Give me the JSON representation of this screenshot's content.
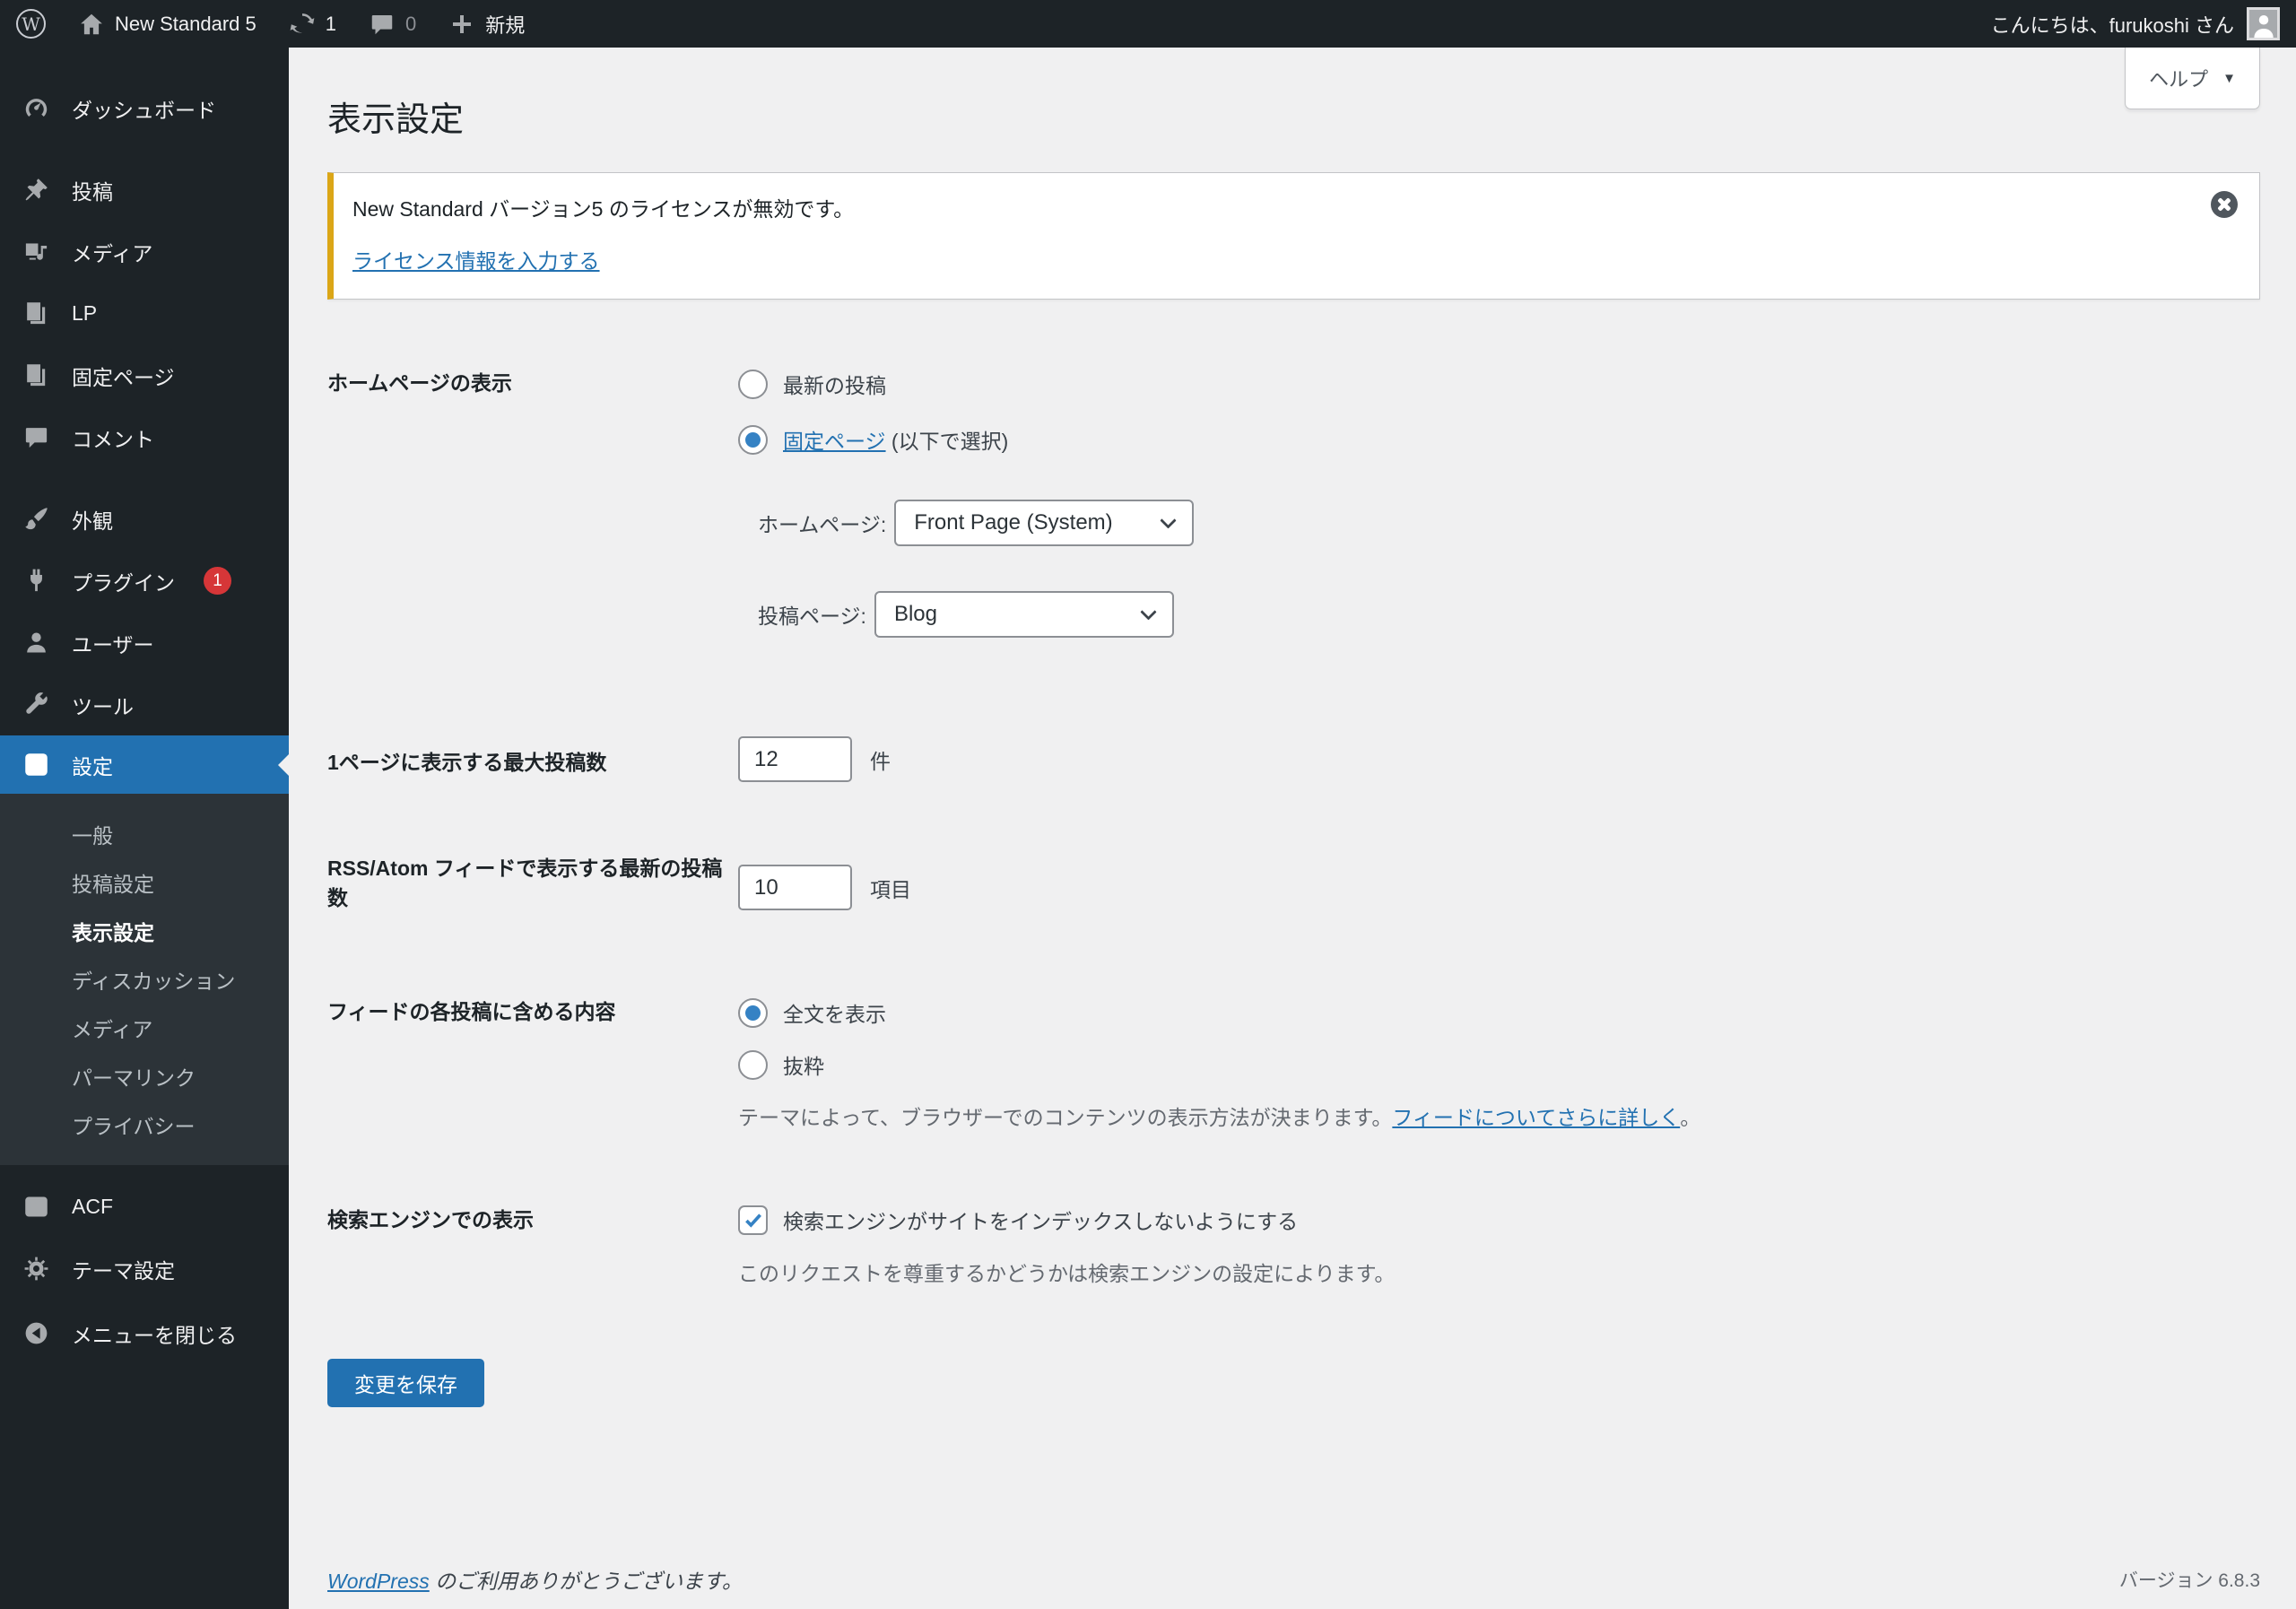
{
  "admin_bar": {
    "wp_logo_glyph": "W",
    "site_name": "New Standard 5",
    "update_count": "1",
    "comment_count": "0",
    "new_label": "新規",
    "greeting": "こんにちは、furukoshi さん"
  },
  "sidebar": {
    "items": [
      {
        "label": "ダッシュボード"
      },
      {
        "label": "投稿"
      },
      {
        "label": "メディア"
      },
      {
        "label": "LP"
      },
      {
        "label": "固定ページ"
      },
      {
        "label": "コメント"
      },
      {
        "label": "外観"
      },
      {
        "label": "プラグイン",
        "badge": "1"
      },
      {
        "label": "ユーザー"
      },
      {
        "label": "ツール"
      },
      {
        "label": "設定"
      }
    ],
    "settings_submenu": [
      "一般",
      "投稿設定",
      "表示設定",
      "ディスカッション",
      "メディア",
      "パーマリンク",
      "プライバシー"
    ],
    "bottom_items": [
      "ACF",
      "テーマ設定",
      "メニューを閉じる"
    ]
  },
  "page": {
    "title": "表示設定",
    "help_label": "ヘルプ",
    "help_caret": "▼"
  },
  "notice": {
    "message": "New Standard バージョン5 のライセンスが無効です。",
    "link": "ライセンス情報を入力する"
  },
  "form": {
    "homepage_row": {
      "label": "ホームページの表示",
      "radio_latest": "最新の投稿",
      "radio_static_link": "固定ページ",
      "radio_static_suffix": " (以下で選択)",
      "homepage_select_label": "ホームページ:",
      "homepage_select_value": "Front Page (System)",
      "posts_select_label": "投稿ページ:",
      "posts_select_value": "Blog"
    },
    "per_page_row": {
      "label": "1ページに表示する最大投稿数",
      "value": "12",
      "suffix": "件"
    },
    "rss_row": {
      "label": "RSS/Atom フィードで表示する最新の投稿数",
      "value": "10",
      "suffix": "項目"
    },
    "feed_row": {
      "label": "フィードの各投稿に含める内容",
      "radio_full": "全文を表示",
      "radio_excerpt": "抜粋",
      "description": "テーマによって、ブラウザーでのコンテンツの表示方法が決まります。",
      "description_link": "フィードについてさらに詳しく",
      "description_suffix": "。"
    },
    "search_row": {
      "label": "検索エンジンでの表示",
      "checkbox_label": "検索エンジンがサイトをインデックスしないようにする",
      "description": "このリクエストを尊重するかどうかは検索エンジンの設定によります。"
    },
    "save_button": "変更を保存"
  },
  "footer": {
    "thanks_link": "WordPress",
    "thanks_text": " のご利用ありがとうございます。",
    "version": "バージョン 6.8.3"
  },
  "colors": {
    "accent": "#2271b1",
    "admin_dark": "#1d2327",
    "submenu_bg": "#2c3338",
    "notice_border": "#dba617",
    "badge": "#d63638",
    "content_bg": "#f0f0f1"
  }
}
